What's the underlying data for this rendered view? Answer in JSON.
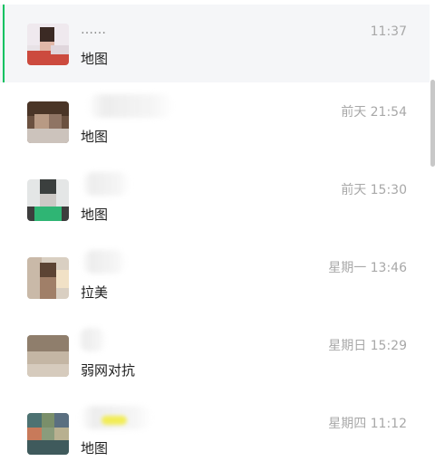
{
  "chats": [
    {
      "name": "……",
      "time": "11:37",
      "preview": "地图"
    },
    {
      "name": "",
      "time": "前天 21:54",
      "preview": "地图"
    },
    {
      "name": "",
      "time": "前天 15:30",
      "preview": "地图"
    },
    {
      "name": "",
      "time": "星期一 13:46",
      "preview": "拉美"
    },
    {
      "name": "",
      "time": "星期日 15:29",
      "preview": "弱网对抗"
    },
    {
      "name": "",
      "time": "星期四 11:12",
      "preview": "地图"
    }
  ],
  "colors": {
    "selected_background": "#f5f6f8",
    "selected_indicator": "#07c160",
    "time_text": "#a8a8a8",
    "preview_text": "#1f1f1f"
  }
}
